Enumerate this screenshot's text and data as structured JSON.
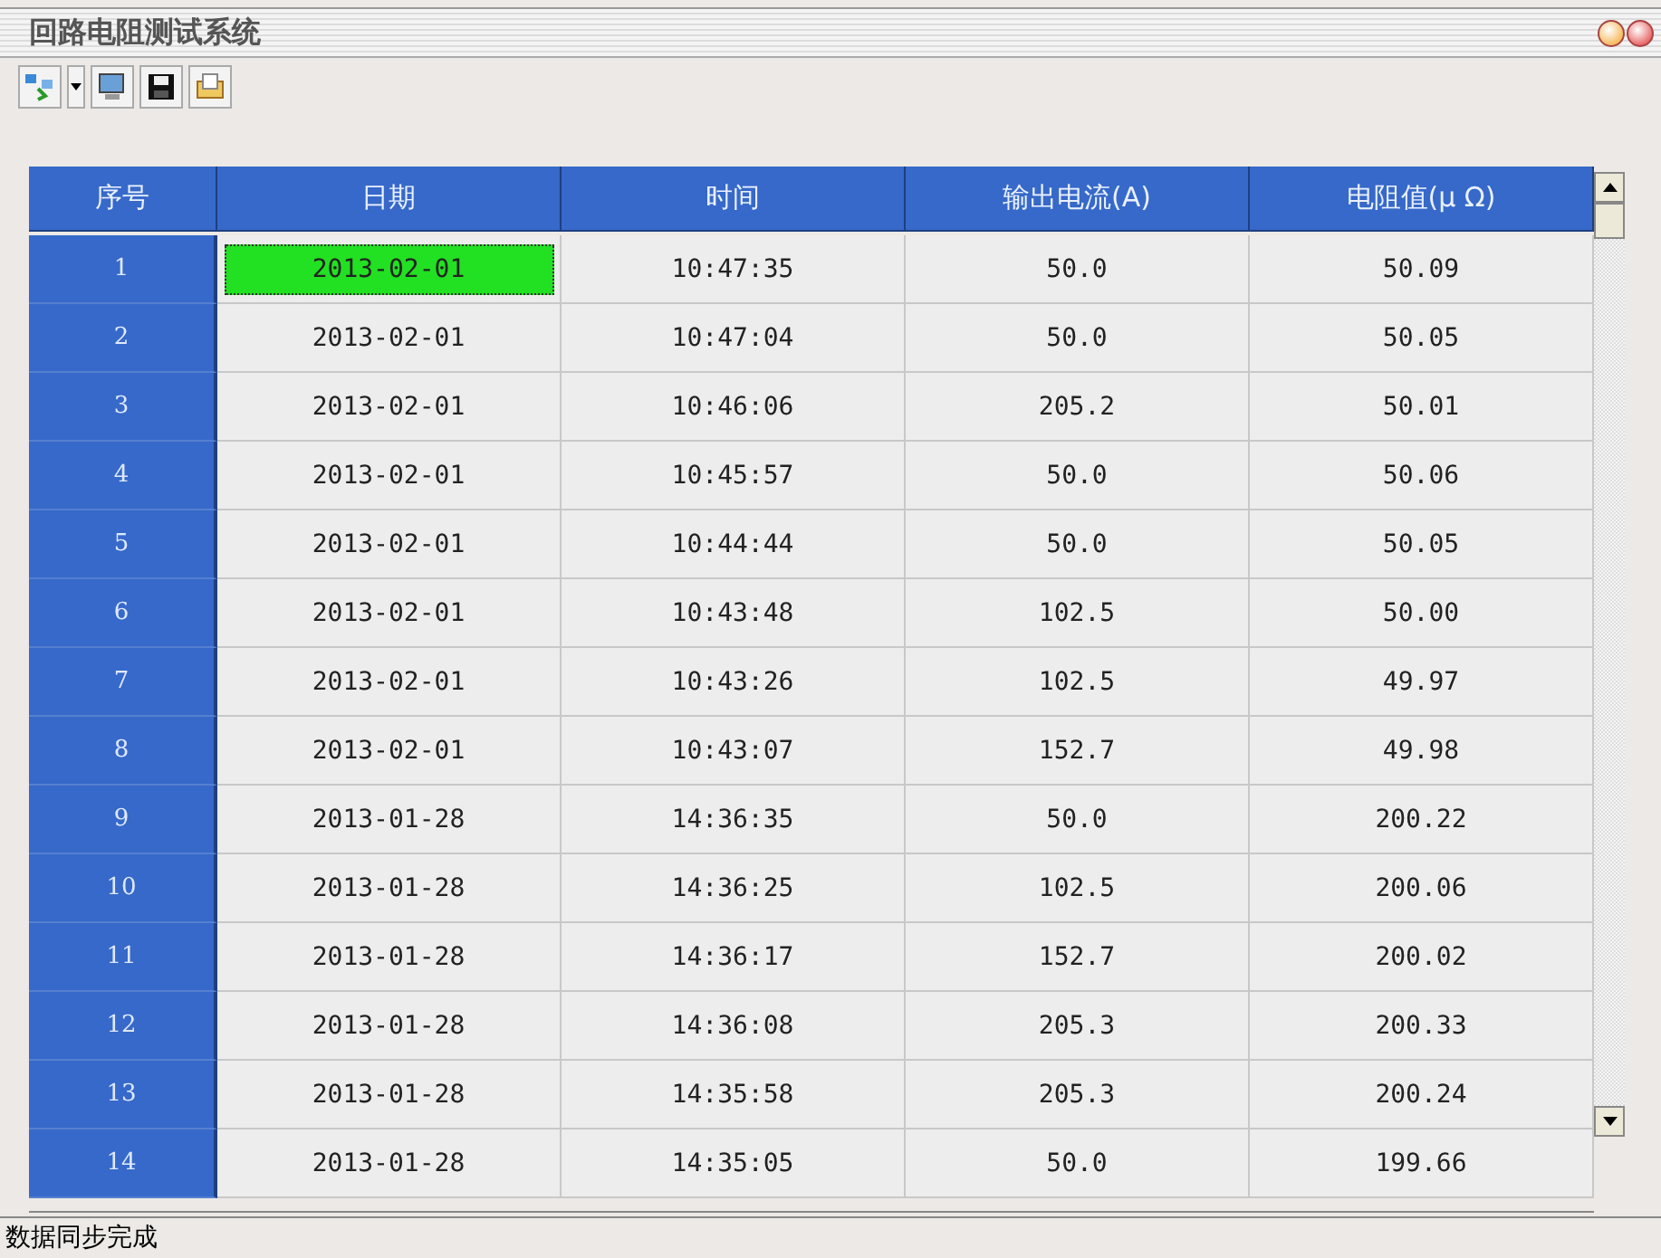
{
  "window": {
    "title": "回路电阻测试系统"
  },
  "table": {
    "columns": [
      "序号",
      "日期",
      "时间",
      "输出电流(A)",
      "电阻值(μ Ω)"
    ],
    "rows": [
      {
        "index": "1",
        "date": "2013-02-01",
        "time": "10:47:35",
        "current": "50.0",
        "resistance": "50.09",
        "selected": true
      },
      {
        "index": "2",
        "date": "2013-02-01",
        "time": "10:47:04",
        "current": "50.0",
        "resistance": "50.05",
        "selected": false
      },
      {
        "index": "3",
        "date": "2013-02-01",
        "time": "10:46:06",
        "current": "205.2",
        "resistance": "50.01",
        "selected": false
      },
      {
        "index": "4",
        "date": "2013-02-01",
        "time": "10:45:57",
        "current": "50.0",
        "resistance": "50.06",
        "selected": false
      },
      {
        "index": "5",
        "date": "2013-02-01",
        "time": "10:44:44",
        "current": "50.0",
        "resistance": "50.05",
        "selected": false
      },
      {
        "index": "6",
        "date": "2013-02-01",
        "time": "10:43:48",
        "current": "102.5",
        "resistance": "50.00",
        "selected": false
      },
      {
        "index": "7",
        "date": "2013-02-01",
        "time": "10:43:26",
        "current": "102.5",
        "resistance": "49.97",
        "selected": false
      },
      {
        "index": "8",
        "date": "2013-02-01",
        "time": "10:43:07",
        "current": "152.7",
        "resistance": "49.98",
        "selected": false
      },
      {
        "index": "9",
        "date": "2013-01-28",
        "time": "14:36:35",
        "current": "50.0",
        "resistance": "200.22",
        "selected": false
      },
      {
        "index": "10",
        "date": "2013-01-28",
        "time": "14:36:25",
        "current": "102.5",
        "resistance": "200.06",
        "selected": false
      },
      {
        "index": "11",
        "date": "2013-01-28",
        "time": "14:36:17",
        "current": "152.7",
        "resistance": "200.02",
        "selected": false
      },
      {
        "index": "12",
        "date": "2013-01-28",
        "time": "14:36:08",
        "current": "205.3",
        "resistance": "200.33",
        "selected": false
      },
      {
        "index": "13",
        "date": "2013-01-28",
        "time": "14:35:58",
        "current": "205.3",
        "resistance": "200.24",
        "selected": false
      },
      {
        "index": "14",
        "date": "2013-01-28",
        "time": "14:35:05",
        "current": "50.0",
        "resistance": "199.66",
        "selected": false
      }
    ]
  },
  "status_bar": {
    "text": "数据同步完成"
  }
}
